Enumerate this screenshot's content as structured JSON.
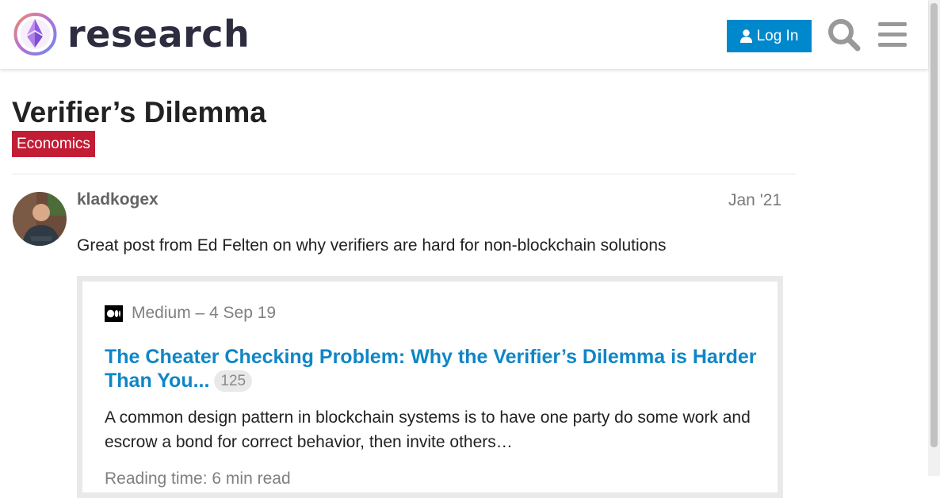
{
  "header": {
    "logo_text": "research",
    "login_label": "Log In",
    "search_icon": "search-icon",
    "menu_icon": "hamburger-menu-icon"
  },
  "topic": {
    "title": "Verifier’s Dilemma",
    "category": "Economics",
    "category_color": "#c21d35"
  },
  "post": {
    "username": "kladkogex",
    "date": "Jan '21",
    "text": "Great post from Ed Felten on why verifiers are hard for non-blockchain solutions"
  },
  "onebox": {
    "source": "Medium – 4 Sep 19",
    "title": "The Cheater Checking Problem: Why the Verifier’s Dilemma is Harder Than You...",
    "clicks": "125",
    "description": "A common design pattern in blockchain systems is to have one party do some work and escrow a bond for correct behavior, then invite others…",
    "reading_time": "Reading time: 6 min read"
  },
  "colors": {
    "accent": "#0088cc",
    "link": "#0f86c6"
  }
}
